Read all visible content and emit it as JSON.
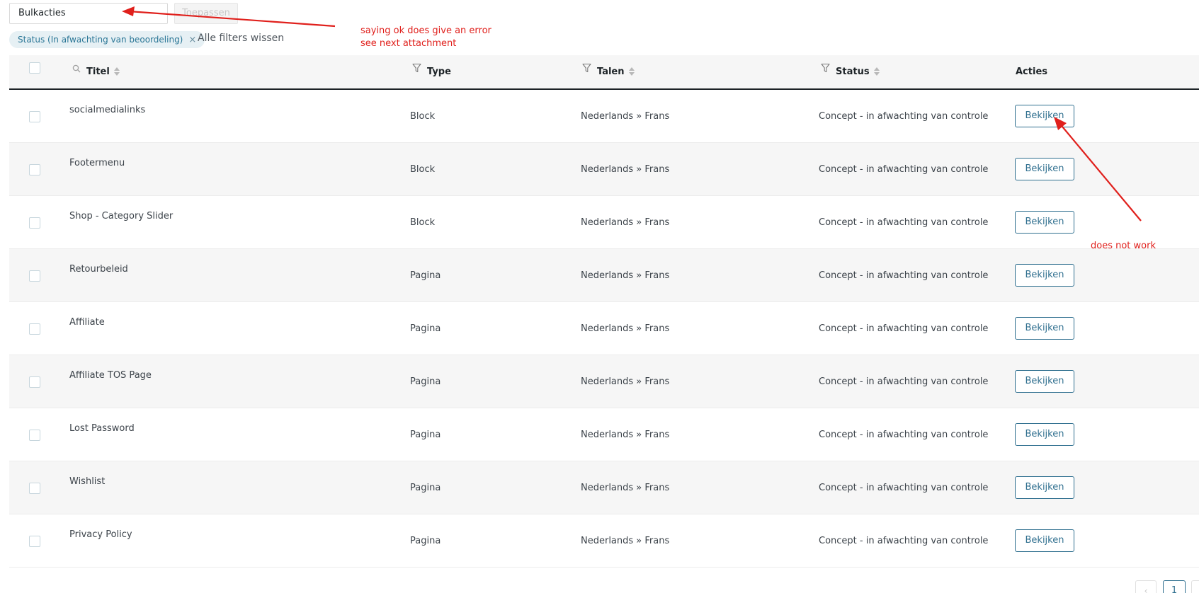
{
  "toolbar": {
    "bulk_actions_value": "Bulkacties",
    "apply_label": "Toepassen",
    "active_filter": "Status (In afwachting van beoordeling)",
    "clear_filters": "Alle filters wissen"
  },
  "table": {
    "columns": {
      "title": "Titel",
      "type": "Type",
      "languages": "Talen",
      "status": "Status",
      "actions": "Acties"
    },
    "rows": [
      {
        "title": "socialmedialinks",
        "type": "Block",
        "languages": "Nederlands » Frans",
        "status": "Concept - in afwachting van controle",
        "action": "Bekijken"
      },
      {
        "title": "Footermenu",
        "type": "Block",
        "languages": "Nederlands » Frans",
        "status": "Concept - in afwachting van controle",
        "action": "Bekijken"
      },
      {
        "title": "Shop - Category Slider",
        "type": "Block",
        "languages": "Nederlands » Frans",
        "status": "Concept - in afwachting van controle",
        "action": "Bekijken"
      },
      {
        "title": "Retourbeleid",
        "type": "Pagina",
        "languages": "Nederlands » Frans",
        "status": "Concept - in afwachting van controle",
        "action": "Bekijken"
      },
      {
        "title": "Affiliate",
        "type": "Pagina",
        "languages": "Nederlands » Frans",
        "status": "Concept - in afwachting van controle",
        "action": "Bekijken"
      },
      {
        "title": "Affiliate TOS Page",
        "type": "Pagina",
        "languages": "Nederlands » Frans",
        "status": "Concept - in afwachting van controle",
        "action": "Bekijken"
      },
      {
        "title": "Lost Password",
        "type": "Pagina",
        "languages": "Nederlands » Frans",
        "status": "Concept - in afwachting van controle",
        "action": "Bekijken"
      },
      {
        "title": "Wishlist",
        "type": "Pagina",
        "languages": "Nederlands » Frans",
        "status": "Concept - in afwachting van controle",
        "action": "Bekijken"
      },
      {
        "title": "Privacy Policy",
        "type": "Pagina",
        "languages": "Nederlands » Frans",
        "status": "Concept - in afwachting van controle",
        "action": "Bekijken"
      }
    ]
  },
  "pagination": {
    "current_page": "1",
    "prev_icon": "chevron-left-icon"
  },
  "annotations": {
    "bulk_note_line1": "saying ok does give an error",
    "bulk_note_line2": "see next attachment",
    "view_note": "does not work",
    "color": "#e0201c"
  },
  "colors": {
    "accent": "#2f6f8f",
    "tag_background": "#e6f0f4",
    "row_alt": "#f6f6f6"
  }
}
